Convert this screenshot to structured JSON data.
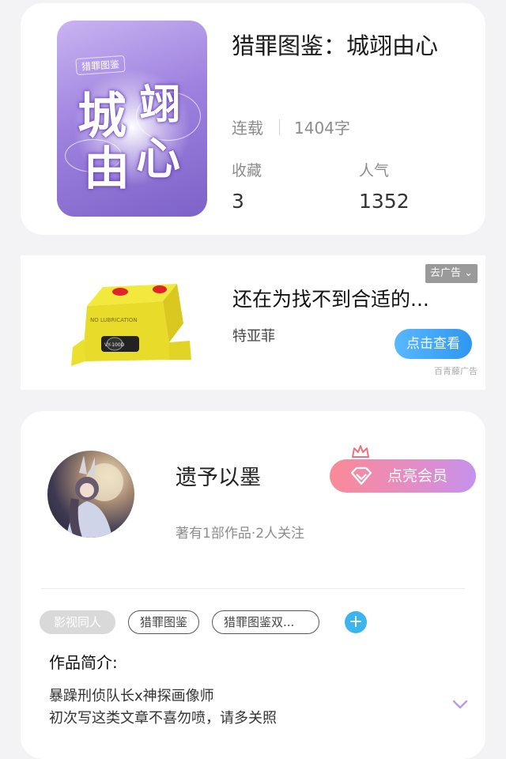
{
  "book": {
    "cover_tag": "猎罪图鉴",
    "cover_chars": [
      "城",
      "翊",
      "由",
      "心"
    ],
    "title": "猎罪图鉴：城翊由心",
    "status": "连载",
    "word_count": "1404字",
    "stats": [
      {
        "label": "收藏",
        "value": "3"
      },
      {
        "label": "人气",
        "value": "1352"
      }
    ]
  },
  "ad": {
    "title": "还在为找不到合适的...",
    "brand": "特亚菲",
    "close_label": "去广告",
    "cta_label": "点击查看",
    "source": "百青藤广告",
    "product_text": "NO LUBRICATION",
    "product_model": "VY-100D"
  },
  "author": {
    "name": "遗予以墨",
    "meta": "著有1部作品·2人关注",
    "vip_label": "点亮会员",
    "tags": [
      "影视同人",
      "猎罪图鉴",
      "猎罪图鉴双..."
    ],
    "add_tag": "+",
    "intro_label": "作品简介:",
    "intro_lines": [
      "暴躁刑侦队长x神探画像师",
      "初次写这类文章不喜勿喷，请多关照"
    ]
  }
}
